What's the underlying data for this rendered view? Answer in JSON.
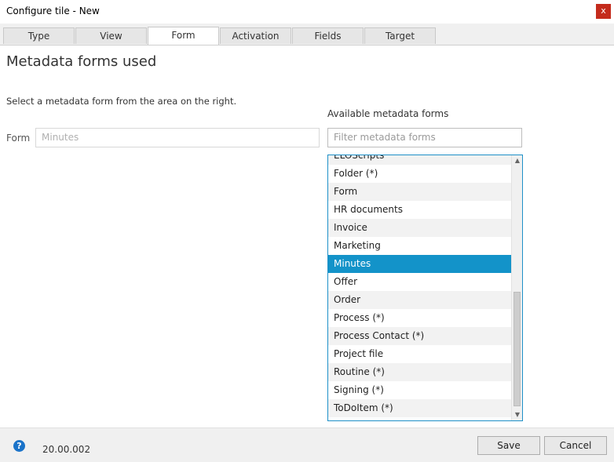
{
  "window": {
    "title": "Configure tile - New",
    "close_glyph": "x"
  },
  "tabs": [
    {
      "label": "Type"
    },
    {
      "label": "View"
    },
    {
      "label": "Form",
      "active": true
    },
    {
      "label": "Activation"
    },
    {
      "label": "Fields"
    },
    {
      "label": "Target"
    }
  ],
  "main": {
    "heading": "Metadata forms used",
    "instruction": "Select a metadata form from the area on the right.",
    "form_label": "Form",
    "form_value": "Minutes",
    "available_label": "Available metadata forms",
    "filter_placeholder": "Filter metadata forms"
  },
  "list": {
    "items": [
      "ELOScripts",
      "Folder (*)",
      "Form",
      "HR documents",
      "Invoice",
      "Marketing",
      "Minutes",
      "Offer",
      "Order",
      "Process (*)",
      "Process Contact (*)",
      "Project file",
      "Routine (*)",
      "Signing (*)",
      "ToDoItem (*)"
    ],
    "selected": "Minutes"
  },
  "footer": {
    "help_glyph": "?",
    "version": "20.00.002",
    "save_label": "Save",
    "cancel_label": "Cancel"
  },
  "colors": {
    "accent": "#1393c9",
    "close": "#c42b1c"
  },
  "icons": {
    "help": "help-icon",
    "close": "close-icon",
    "scroll_up": "chevron-up-icon",
    "scroll_down": "chevron-down-icon"
  }
}
